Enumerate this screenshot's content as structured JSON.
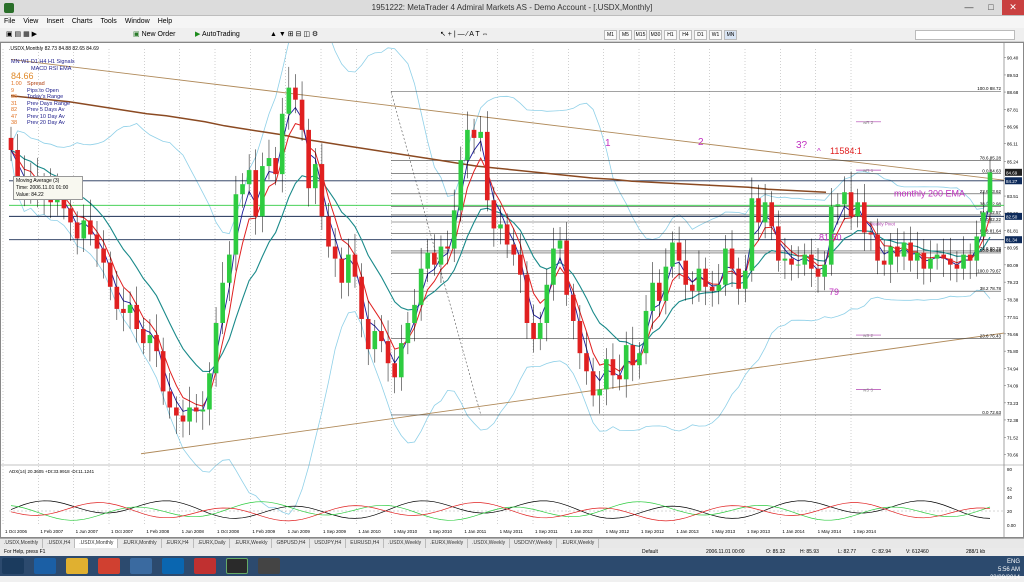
{
  "window": {
    "title": "1951222: MetaTrader 4 Admiral Markets AS - Demo Account - [.USDX,Monthly]"
  },
  "menu": [
    "File",
    "View",
    "Insert",
    "Charts",
    "Tools",
    "Window",
    "Help"
  ],
  "toolbar": {
    "new_order": "New Order",
    "autotrading": "AutoTrading",
    "timeframes": [
      "M1",
      "M5",
      "M15",
      "M30",
      "H1",
      "H4",
      "D1",
      "W1",
      "MN"
    ]
  },
  "chart": {
    "info": ".USDX,Monthly  82.73 84.88 82.65 84.69",
    "legend_top": "MN W1 D1 H4 H1 Signals",
    "legend_sub": [
      "MACD",
      "RSI",
      "EMA"
    ],
    "price_big": "84.66",
    "stats": [
      {
        "n": "1.00",
        "t": "Spread"
      },
      {
        "n": "9",
        "t": "Pips to Open"
      },
      {
        "n": "36",
        "t": "Today's Range"
      },
      {
        "n": "31",
        "t": "Prev Days Range"
      },
      {
        "n": "82",
        "t": "Prev 5 Days Av"
      },
      {
        "n": "47",
        "t": "Prev 10 Day Av"
      },
      {
        "n": "38",
        "t": "Prev 20 Day Av"
      }
    ],
    "tooltip": {
      "line1": "Moving Average (3)",
      "line2": "Time: 2006.11.01 01:00",
      "line3": "Value: 84.22"
    },
    "annotations": {
      "label_1": "1",
      "label_2": "2",
      "label_3": "3?",
      "label_11584": "11584:1",
      "label_200ema": "monthly 200 EMA",
      "label_8150": "81.50",
      "label_79": "79",
      "weekly_pivot": "Weekly Pivot",
      "wr2": "wR 2",
      "wr1": "wR 1",
      "ws2": "wS 2",
      "ws3": "wS 3"
    },
    "fib_labels": [
      {
        "t": "100.0  88.72",
        "p": 88.72
      },
      {
        "t": "78.6  85.28",
        "p": 85.28
      },
      {
        "t": "0.0  84.63",
        "p": 84.63
      },
      {
        "t": "23.6  83.62",
        "p": 83.62
      },
      {
        "t": "38.2  82.98",
        "p": 82.98
      },
      {
        "t": "61.8  82.57",
        "p": 82.57
      },
      {
        "t": "50.0  82.22",
        "p": 82.22
      },
      {
        "t": "61.8  81.64",
        "p": 81.64
      },
      {
        "t": "78.6  80.78",
        "p": 80.78
      },
      {
        "t": "50.0  80.68",
        "p": 80.68
      },
      {
        "t": "100.0  79.67",
        "p": 79.67
      },
      {
        "t": "38.2  78.78",
        "p": 78.78
      },
      {
        "t": "23.6  76.43",
        "p": 76.43
      },
      {
        "t": "0.0  72.63",
        "p": 72.63
      }
    ],
    "price_axis": [
      "90.40",
      "89.53",
      "88.68",
      "87.81",
      "86.96",
      "86.11",
      "85.24",
      "84.38",
      "83.51",
      "82.66",
      "81.81",
      "80.95",
      "80.09",
      "79.23",
      "78.38",
      "77.51",
      "76.66",
      "75.80",
      "74.94",
      "74.09",
      "73.23",
      "72.38",
      "71.52",
      "70.66"
    ],
    "price_range": [
      70.24,
      90.82
    ],
    "current_prices": [
      {
        "t": "84.69",
        "p": 84.69,
        "c": "#1f1f1f"
      },
      {
        "t": "84.27",
        "p": 84.27,
        "c": "#0d2a5a"
      },
      {
        "t": "82.50",
        "p": 82.5,
        "c": "#0d2a5a"
      },
      {
        "t": "81.34",
        "p": 81.34,
        "c": "#0d2a5a"
      }
    ],
    "date_axis": [
      "1 Oct 2006",
      "1 Feb 2007",
      "1 Jun 2007",
      "1 Oct 2007",
      "1 Feb 2008",
      "1 Jun 2008",
      "1 Oct 2008",
      "1 Feb 2009",
      "1 Jun 2009",
      "1 Sep 2009",
      "1 Jan 2010",
      "1 May 2010",
      "1 Sep 2010",
      "1 Jan 2011",
      "1 May 2011",
      "1 Sep 2011",
      "1 Jan 2012",
      "1 May 2012",
      "1 Sep 2012",
      "1 Jan 2013",
      "1 May 2013",
      "1 Sep 2013",
      "1 Jan 2014",
      "1 May 2014",
      "1 Sep 2014"
    ],
    "adx": {
      "label": "ADX(14) 20.3605 +DI:33.9918 -DI:11.1241",
      "axis": [
        "80",
        "52",
        "40",
        "20",
        "0.00"
      ],
      "range": [
        0,
        80
      ]
    },
    "closes": [
      85.8,
      84.5,
      83.8,
      84.5,
      83.5,
      84.1,
      83.2,
      83.6,
      82.9,
      82.2,
      81.4,
      82.3,
      81.6,
      80.9,
      80.2,
      79.0,
      77.9,
      77.7,
      78.1,
      76.9,
      76.2,
      76.6,
      75.8,
      73.8,
      73.0,
      72.6,
      72.3,
      73.0,
      72.8,
      72.9,
      74.7,
      77.2,
      79.2,
      80.6,
      83.6,
      84.1,
      84.8,
      82.5,
      85.0,
      85.4,
      84.6,
      87.6,
      88.9,
      88.3,
      86.8,
      83.9,
      85.1,
      82.5,
      81.0,
      80.4,
      79.2,
      80.6,
      79.5,
      77.4,
      75.9,
      76.8,
      76.3,
      75.2,
      74.5,
      76.2,
      77.2,
      78.1,
      79.9,
      80.7,
      80.1,
      81.0,
      80.9,
      82.8,
      85.3,
      86.8,
      86.4,
      86.7,
      83.3,
      81.9,
      82.1,
      81.1,
      80.6,
      79.6,
      77.2,
      76.4,
      77.2,
      79.1,
      80.9,
      81.3,
      78.6,
      77.3,
      75.7,
      74.8,
      73.6,
      73.9,
      75.4,
      74.6,
      74.4,
      76.1,
      75.1,
      75.7,
      77.8,
      79.2,
      78.3,
      80.0,
      81.2,
      80.3,
      79.1,
      78.8,
      79.9,
      79.0,
      78.8,
      79.1,
      80.9,
      79.9,
      78.9,
      79.8,
      83.4,
      82.2,
      83.2,
      82.0,
      80.3,
      80.4,
      80.1,
      80.1,
      80.6,
      79.9,
      79.5,
      80.1,
      83.0,
      83.1,
      83.7,
      82.5,
      83.2,
      81.7,
      81.6,
      80.3,
      80.1,
      81.0,
      80.5,
      81.2,
      80.3,
      80.7,
      79.9,
      80.4,
      80.6,
      80.4,
      80.1,
      79.9,
      80.6,
      80.3,
      81.5,
      82.7,
      84.69
    ],
    "ema200": [
      88.5,
      88.4,
      88.3,
      88.2,
      88.05,
      87.9,
      87.75,
      87.6,
      87.5,
      87.35,
      87.2,
      87.0,
      86.85,
      86.7,
      86.55,
      86.35,
      86.2,
      86.05,
      85.9,
      85.75,
      85.6,
      85.45,
      85.3,
      85.15,
      85.0,
      84.9,
      84.8,
      84.7,
      84.6,
      84.5,
      84.4,
      84.35,
      84.25,
      84.2,
      84.15,
      84.1,
      84.05,
      84.0,
      83.95,
      83.85,
      83.8,
      83.75,
      83.7
    ],
    "ma_period": 13
  },
  "tabs": [
    ".USDX,Monthly",
    ".USDX,H4",
    ".USDX,Monthly",
    ".EURX,Monthly",
    ".EURX,H4",
    ".EURX,Daily",
    ".EURX,Weekly",
    "GBPUSD,H4",
    "USDJPY,H4",
    "EURUSD,H4",
    ".USDX,Weekly",
    ".EURX,Weekly",
    ".USDX,Weekly",
    "USDCNY,Weekly",
    ".EURX,Weekly"
  ],
  "active_tab": 2,
  "status": {
    "help": "For Help, press F1",
    "profile": "Default",
    "time": "2006.11.01 00:00",
    "o": "O: 85.32",
    "h": "H: 85.93",
    "l": "L: 82.77",
    "c": "C: 82.94",
    "v": "V: 612460",
    "mem": "288/1 kb"
  },
  "tray": {
    "time": "5:56 AM",
    "date": "23/09/2014",
    "lang": "ENG"
  }
}
